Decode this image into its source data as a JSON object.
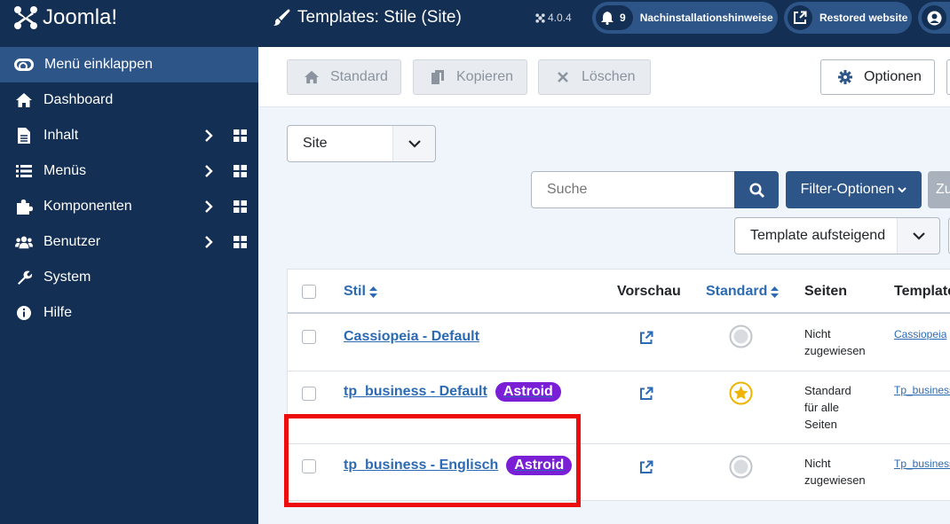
{
  "brand": {
    "name": "Joomla!"
  },
  "sidebar": {
    "collapse_label": "Menü einklappen",
    "items": [
      {
        "label": "Dashboard",
        "icon": "home-icon"
      },
      {
        "label": "Inhalt",
        "icon": "file-icon"
      },
      {
        "label": "Menüs",
        "icon": "list-icon"
      },
      {
        "label": "Komponenten",
        "icon": "puzzle-icon"
      },
      {
        "label": "Benutzer",
        "icon": "users-icon"
      },
      {
        "label": "System",
        "icon": "wrench-icon"
      },
      {
        "label": "Hilfe",
        "icon": "info-icon"
      }
    ]
  },
  "header": {
    "title": "Templates: Stile (Site)",
    "version": "4.0.4",
    "notifications": {
      "count": "9",
      "label": "Nachinstallationshinweise"
    },
    "restored_label": "Restored website"
  },
  "toolbar": {
    "standard": "Standard",
    "copy": "Kopieren",
    "delete": "Löschen",
    "options": "Optionen"
  },
  "filters": {
    "client_select": "Site",
    "search_placeholder": "Suche",
    "filter_options": "Filter-Optionen",
    "clear": "Zu",
    "sort_select": "Template aufsteigend"
  },
  "table": {
    "headers": {
      "style": "Stil",
      "preview": "Vorschau",
      "default": "Standard",
      "pages": "Seiten",
      "template": "Template"
    },
    "rows": [
      {
        "style": "Cassiopeia - Default",
        "badge": "",
        "pages": [
          "Nicht",
          "zugewiesen"
        ],
        "template": "Cassiopeia",
        "is_default": false
      },
      {
        "style": "tp_business - Default",
        "badge": "Astroid",
        "pages": [
          "Standard",
          "für alle",
          "Seiten"
        ],
        "template": "Tp_business",
        "is_default": true
      },
      {
        "style": "tp_business - Englisch",
        "badge": "Astroid",
        "pages": [
          "Nicht",
          "zugewiesen"
        ],
        "template": "Tp_business",
        "is_default": false
      }
    ]
  },
  "colors": {
    "sidebar_bg": "#132f53",
    "accent": "#2d5587",
    "link": "#2c6bb3",
    "badge": "#7a1fd6",
    "highlight": "#ee0d0d",
    "star": "#f0b400"
  }
}
